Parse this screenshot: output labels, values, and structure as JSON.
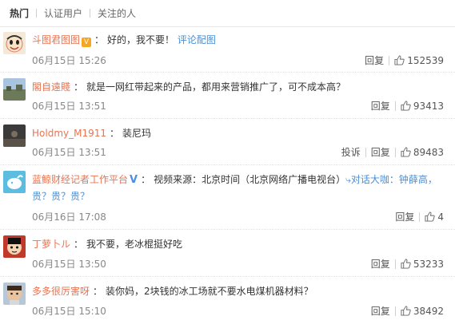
{
  "tabs": [
    "热门",
    "认证用户",
    "关注的人"
  ],
  "comments": [
    {
      "user": "斗图君图图",
      "text": "好的，我不要！",
      "link": "评论配图",
      "time": "06月15日 15:26",
      "reply": "回复",
      "likes": "152539",
      "avatar": "cartoon-face"
    },
    {
      "user": "閣自遠賤",
      "text": "就是一网红带起来的产品，都用来营销推广了，可不成本高？",
      "time": "06月15日 13:51",
      "reply": "回复",
      "likes": "93413",
      "avatar": "landscape-photo"
    },
    {
      "user": "Holdmy_M1911",
      "text": "装尼玛",
      "time": "06月15日 13:51",
      "report": "投诉",
      "reply": "回复",
      "likes": "89483",
      "avatar": "dark-photo"
    },
    {
      "user": "蓝鲸财经记者工作平台",
      "text": "视频来源：北京时间（北京网络广播电视台）",
      "link": "对话大咖：钟薛高，贵？贵？贵？",
      "time": "06月16日 17:08",
      "reply": "回复",
      "likes": "4",
      "avatar": "whale-logo"
    },
    {
      "user": "丁萝卜ル",
      "text": "我不要，老冰棍挺好吃",
      "time": "06月15日 13:50",
      "reply": "回复",
      "likes": "53233",
      "avatar": "red-cartoon"
    },
    {
      "user": "多多很厉害呀",
      "text": "装你妈，2块钱的冰工场就不要水电煤机器材料？",
      "time": "06月15日 15:10",
      "reply": "回复",
      "likes": "38492",
      "avatar": "child-photo"
    }
  ]
}
